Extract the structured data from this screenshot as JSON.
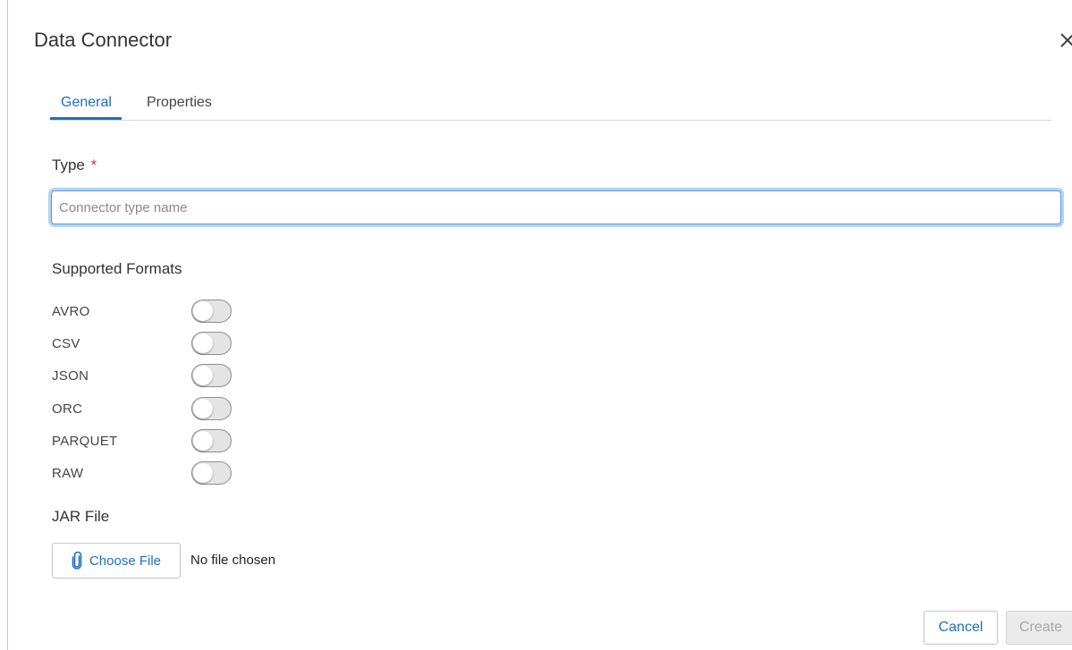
{
  "dialog": {
    "title": "Data Connector",
    "close_icon": "close-icon"
  },
  "tabs": [
    {
      "label": "General",
      "active": true
    },
    {
      "label": "Properties",
      "active": false
    }
  ],
  "type_field": {
    "label": "Type",
    "required_mark": "*",
    "value": "",
    "placeholder": "Connector type name"
  },
  "formats": {
    "heading": "Supported Formats",
    "items": [
      {
        "label": "AVRO",
        "enabled": false
      },
      {
        "label": "CSV",
        "enabled": false
      },
      {
        "label": "JSON",
        "enabled": false
      },
      {
        "label": "ORC",
        "enabled": false
      },
      {
        "label": "PARQUET",
        "enabled": false
      },
      {
        "label": "RAW",
        "enabled": false
      }
    ]
  },
  "jar": {
    "heading": "JAR File",
    "button_label": "Choose File",
    "button_icon": "paperclip-icon",
    "status": "No file chosen"
  },
  "footer": {
    "cancel_label": "Cancel",
    "create_label": "Create"
  },
  "colors": {
    "accent": "#1f6fc5",
    "required": "#d9323a",
    "input_focus": "#b3d4f3",
    "disabled_text": "#a8a8a8"
  }
}
